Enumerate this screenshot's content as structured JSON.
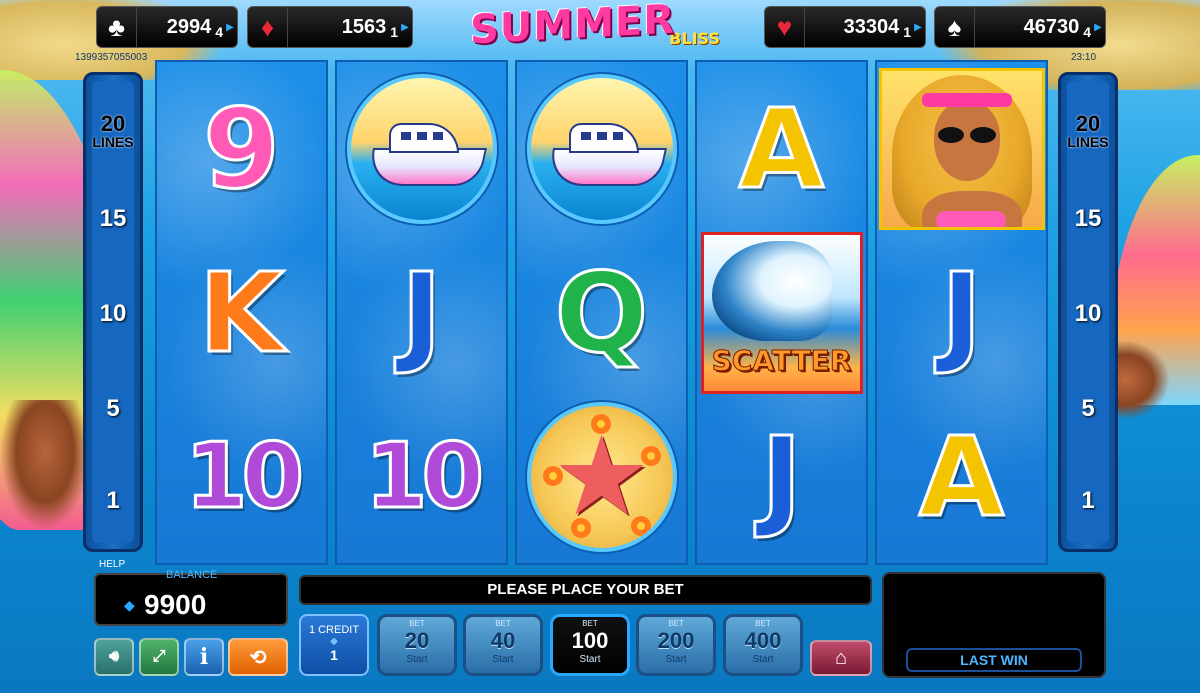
{
  "jackpots": [
    {
      "suit": "clubs",
      "icon": "♣",
      "value": "2994",
      "sub": "4"
    },
    {
      "suit": "diamonds",
      "icon": "♦",
      "value": "1563",
      "sub": "1"
    },
    {
      "suit": "hearts",
      "icon": "♥",
      "value": "33304",
      "sub": "1"
    },
    {
      "suit": "spades",
      "icon": "♠",
      "value": "46730",
      "sub": "4"
    }
  ],
  "session_id": "1399357055003",
  "clock": "23:10",
  "logo": {
    "title": "SUMMER",
    "subtitle": "BLISS"
  },
  "lines_panel": {
    "count": "20",
    "word": "LINES",
    "markers": [
      "15",
      "10",
      "5",
      "1"
    ]
  },
  "reels": [
    [
      "9",
      "K",
      "10"
    ],
    [
      "yacht",
      "J",
      "10"
    ],
    [
      "yacht",
      "Q",
      "starfish"
    ],
    [
      "A",
      "SCATTER",
      "J"
    ],
    [
      "lady",
      "J",
      "A"
    ]
  ],
  "help_label": "HELP",
  "balance": {
    "label": "BALANCE",
    "value": "9900"
  },
  "message": "PLEASE PLACE YOUR BET",
  "credit": {
    "title": "1 CREDIT",
    "value": "1"
  },
  "bets": [
    {
      "label": "BET",
      "value": "20",
      "start": "Start"
    },
    {
      "label": "BET",
      "value": "40",
      "start": "Start"
    },
    {
      "label": "BET",
      "value": "100",
      "start": "Start",
      "active": true
    },
    {
      "label": "BET",
      "value": "200",
      "start": "Start"
    },
    {
      "label": "BET",
      "value": "400",
      "start": "Start"
    }
  ],
  "last_win": {
    "label": "LAST WIN"
  },
  "colors": {
    "nine": "#ff5ab5",
    "K": "#ff7a1a",
    "ten": "#b04ad8",
    "J": "#1a5fd8",
    "Q": "#1fb34a",
    "A": "#f5c400"
  }
}
